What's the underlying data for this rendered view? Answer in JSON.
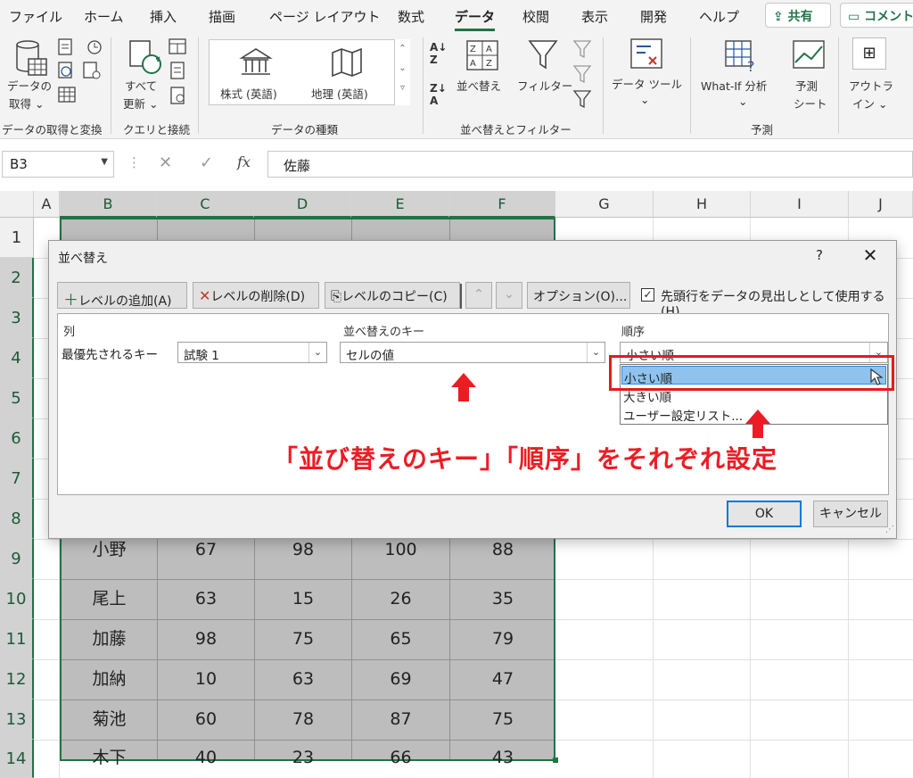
{
  "ribbon": {
    "tabs": [
      "ファイル",
      "ホーム",
      "挿入",
      "描画",
      "ページ レイアウト",
      "数式",
      "データ",
      "校閲",
      "表示",
      "開発",
      "ヘルプ"
    ],
    "active_tab": "データ",
    "share_label": "共有",
    "comment_label": "コメント",
    "get_data_label_1": "データの",
    "get_data_label_2": "取得 ⌄",
    "refresh_label_1": "すべて",
    "refresh_label_2": "更新 ⌄",
    "stocks_label": "株式 (英語)",
    "geography_label": "地理 (英語)",
    "sort_label": "並べ替え",
    "filter_label": "フィルター",
    "data_tools_label": "データ ツール",
    "whatif_label": "What-If 分析",
    "forecast_label_1": "予測",
    "forecast_label_2": "シート",
    "outline_label_1": "アウトラ",
    "outline_label_2": "イン ⌄",
    "groups": {
      "get_transform": "データの取得と変換",
      "queries": "クエリと接続",
      "data_types": "データの種類",
      "sort_filter": "並べ替えとフィルター",
      "forecast": "予測"
    }
  },
  "formula_bar": {
    "name_box": "B3",
    "fx": "fx",
    "value": "佐藤"
  },
  "grid": {
    "columns": [
      "A",
      "B",
      "C",
      "D",
      "E",
      "F",
      "G",
      "H",
      "I",
      "J"
    ],
    "rows": [
      "1",
      "2",
      "3",
      "4",
      "5",
      "6",
      "7",
      "8",
      "9",
      "10",
      "11",
      "12",
      "13",
      "14"
    ],
    "visible_data": [
      [
        "小野",
        "67",
        "98",
        "100",
        "88"
      ],
      [
        "尾上",
        "63",
        "15",
        "26",
        "35"
      ],
      [
        "加藤",
        "98",
        "75",
        "65",
        "79"
      ],
      [
        "加納",
        "10",
        "63",
        "69",
        "47"
      ],
      [
        "菊池",
        "60",
        "78",
        "87",
        "75"
      ],
      [
        "木下",
        "40",
        "23",
        "66",
        "43"
      ]
    ]
  },
  "dialog": {
    "title": "並べ替え",
    "help": "?",
    "close": "✕",
    "add_level": "レベルの追加(A)",
    "delete_level": "レベルの削除(D)",
    "copy_level": "レベルのコピー(C)",
    "options": "オプション(O)...",
    "header_checkbox_label": "先頭行をデータの見出しとして使用する(H)",
    "col_header_column": "列",
    "col_header_key": "並べ替えのキー",
    "col_header_order": "順序",
    "row_label": "最優先されるキー",
    "column_value": "試験 1",
    "key_value": "セルの値",
    "order_value": "小さい順",
    "order_options": [
      "小さい順",
      "大きい順",
      "ユーザー設定リスト..."
    ],
    "ok": "OK",
    "cancel": "キャンセル"
  },
  "annotation": {
    "caption": "「並び替えのキー」「順序」をそれぞれ設定",
    "color": "#ec1c24"
  }
}
